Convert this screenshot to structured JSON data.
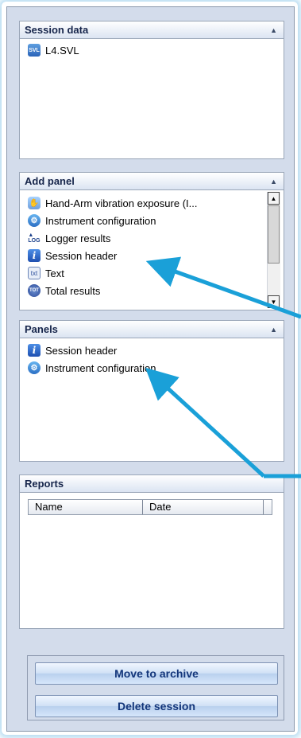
{
  "session_data": {
    "title": "Session data",
    "files": [
      {
        "label": "L4.SVL",
        "icon": "svl-file-icon"
      }
    ]
  },
  "add_panel": {
    "title": "Add panel",
    "items": [
      {
        "label": "Hand-Arm vibration exposure (I...",
        "icon": "hand-icon"
      },
      {
        "label": "Instrument configuration",
        "icon": "config-icon"
      },
      {
        "label": "Logger results",
        "icon": "log-icon"
      },
      {
        "label": "Session header",
        "icon": "info-icon"
      },
      {
        "label": "Text",
        "icon": "txt-icon"
      },
      {
        "label": "Total results",
        "icon": "total-icon"
      }
    ]
  },
  "panels": {
    "title": "Panels",
    "items": [
      {
        "label": "Session header",
        "icon": "info-icon"
      },
      {
        "label": "Instrument configuration",
        "icon": "config-icon"
      }
    ]
  },
  "reports": {
    "title": "Reports",
    "columns": [
      "Name",
      "Date"
    ]
  },
  "buttons": {
    "move_to_archive": "Move to archive",
    "delete_session": "Delete session"
  },
  "colors": {
    "arrow": "#1aa0d8",
    "panel_bg": "#d3dceb",
    "header_text": "#15244a",
    "button_text": "#12357a"
  }
}
